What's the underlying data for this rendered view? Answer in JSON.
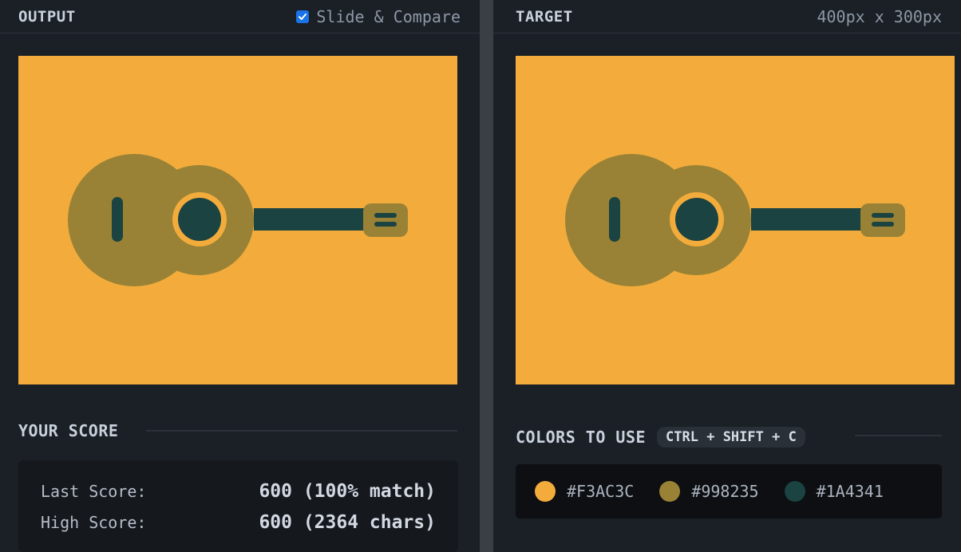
{
  "output_pane": {
    "title": "OUTPUT",
    "compare_label": "Slide & Compare",
    "compare_checked": true
  },
  "target_pane": {
    "title": "TARGET",
    "dimensions": "400px x 300px"
  },
  "score": {
    "title": "YOUR SCORE",
    "last_label": "Last Score:",
    "last_value": "600 (100% match)",
    "high_label": "High Score:",
    "high_value": "600 (2364 chars)"
  },
  "colors": {
    "title": "COLORS TO USE",
    "shortcut": "CTRL + SHIFT + C",
    "swatches": [
      {
        "hex": "#F3AC3C",
        "color": "#F3AC3C"
      },
      {
        "hex": "#998235",
        "color": "#998235"
      },
      {
        "hex": "#1A4341",
        "color": "#1A4341"
      }
    ]
  },
  "illustration": {
    "subject": "guitar-icon",
    "background": "#F3AC3C",
    "body_color": "#998235",
    "detail_color": "#1A4341"
  }
}
